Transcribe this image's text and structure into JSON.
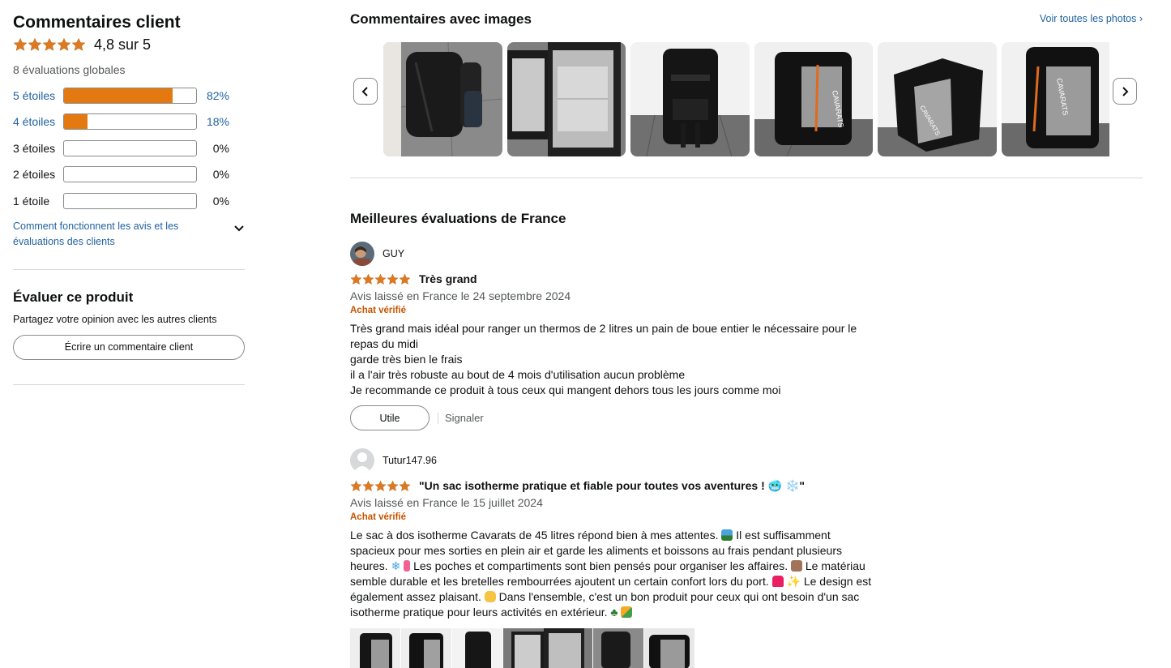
{
  "summary": {
    "title": "Commentaires client",
    "average": "4,8 sur 5",
    "total_ratings": "8 évaluations globales",
    "histogram": [
      {
        "label": "5 étoiles",
        "percent": "82%",
        "fraction": 0.82,
        "link": true
      },
      {
        "label": "4 étoiles",
        "percent": "18%",
        "fraction": 0.18,
        "link": true
      },
      {
        "label": "3 étoiles",
        "percent": "0%",
        "fraction": 0,
        "link": false
      },
      {
        "label": "2 étoiles",
        "percent": "0%",
        "fraction": 0,
        "link": false
      },
      {
        "label": "1 étoile",
        "percent": "0%",
        "fraction": 0,
        "link": false
      }
    ],
    "how_link": "Comment fonctionnent les avis et les évaluations des clients"
  },
  "rate": {
    "title": "Évaluer ce produit",
    "subtitle": "Partagez votre opinion avec les autres clients",
    "button": "Écrire un commentaire client"
  },
  "images_section": {
    "title": "Commentaires avec images",
    "see_all": "Voir toutes les photos ›"
  },
  "top_reviews_title": "Meilleures évaluations de France",
  "reviews": [
    {
      "user": "GUY",
      "title": "Très grand",
      "date": "Avis laissé en France le 24 septembre 2024",
      "verified": "Achat vérifié",
      "body_lines": [
        "Très grand mais idéal pour ranger un thermos de 2 litres un pain de boue entier le nécessaire pour le repas du midi",
        "garde très bien le frais",
        "il a l'air très robuste au bout de 4 mois d'utilisation aucun problème",
        "Je recommande ce produit à tous ceux qui mangent dehors tous les jours comme moi"
      ],
      "helpful": "Utile",
      "report": "Signaler"
    },
    {
      "user": "Tutur147.96",
      "title": "\"Un sac isotherme pratique et fiable pour toutes vos aventures ! 🥶 ❄️\"",
      "date": "Avis laissé en France le 15 juillet 2024",
      "verified": "Achat vérifié",
      "body_parts": [
        "Le sac à dos isotherme Cavarats de 45 litres répond bien à mes attentes. ",
        " Il est suffisamment spacieux pour mes sorties en plein air et garde les aliments et boissons au frais pendant plusieurs heures. ",
        " Les poches et compartiments sont bien pensés pour organiser les affaires. ",
        " Le matériau semble durable et les bretelles rembourrées ajoutent un certain confort lors du port. ",
        " Le design est également assez plaisant. ",
        " Dans l'ensemble, c'est un bon produit pour ceux qui ont besoin d'un sac isotherme pratique pour leurs activités en extérieur. "
      ]
    }
  ],
  "colors": {
    "star": "#de7921",
    "bar_fill": "#e47911",
    "link": "#2162a1",
    "verified": "#c45500"
  }
}
